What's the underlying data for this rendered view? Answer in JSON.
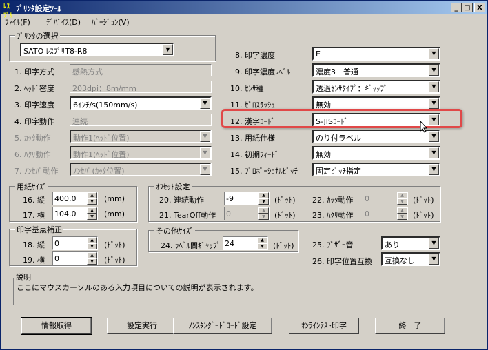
{
  "window": {
    "title": "ﾌﾟﾘﾝﾀ設定ﾂｰﾙ",
    "min": "_",
    "max": "□",
    "close": "X"
  },
  "menu": [
    "ﾌｧｲﾙ(F)",
    "ﾃﾞﾊﾞｲｽ(D)",
    "ﾊﾞｰｼﾞｮﾝ(V)"
  ],
  "printer_select": {
    "title": "ﾌﾟﾘﾝﾀの選択",
    "value": "SATO ﾚｽﾌﾟﾘT8-R8"
  },
  "left_settings": [
    {
      "label": "1. 印字方式",
      "value": "感熱方式",
      "kind": "field"
    },
    {
      "label": "2. ﾍｯﾄﾞ密度",
      "value": "203dpi：8ｍ/ｍｍ",
      "kind": "field"
    },
    {
      "label": "3. 印字速度",
      "value": "6ｲﾝﾁ/s(150mm/s)",
      "kind": "combo"
    },
    {
      "label": "4. 印字動作",
      "value": "連続",
      "kind": "field"
    },
    {
      "label": "5. ｶｯﾀ動作",
      "value": "動作1(ﾍｯﾄﾞ位置)",
      "kind": "disabled"
    },
    {
      "label": "6. ﾊｸﾘ動作",
      "value": "動作1(ﾍｯﾄﾞ位置)",
      "kind": "disabled"
    },
    {
      "label": "7. ﾉﾝｾﾊﾟ動作",
      "value": "ﾉﾝｾﾊﾟ(ｶｯﾀ位置)",
      "kind": "disabled"
    }
  ],
  "right_settings": [
    {
      "label": "8. 印字濃度",
      "value": "E"
    },
    {
      "label": "9. 印字濃度ﾚﾍﾞﾙ",
      "value": "濃度3　普通"
    },
    {
      "label": "10. ｾﾝｻ種",
      "value": "透過ｾﾝｻﾀｲﾌﾟ：ｷﾞｬｯﾌﾟ"
    },
    {
      "label": "11. ｾﾞﾛｽﾗｯｼｭ",
      "value": "無効"
    },
    {
      "label": "12. 漢字ｺｰﾄﾞ",
      "value": "S-JISｺｰﾄﾞ"
    },
    {
      "label": "13. 用紙仕様",
      "value": "のり付ラベル"
    },
    {
      "label": "14. 初期ﾌｨｰﾄﾞ",
      "value": "無効"
    },
    {
      "label": "15. ﾌﾟﾛﾎﾟｰｼｮﾅﾙﾋﾟｯﾁ",
      "value": "固定ﾋﾟｯﾁ指定"
    }
  ],
  "paper_size": {
    "title": "用紙ｻｲｽﾞ",
    "items": [
      {
        "label": "16. 縦",
        "value": "400.0",
        "unit": "(mm)"
      },
      {
        "label": "17. 横",
        "value": "104.0",
        "unit": "(mm)"
      }
    ]
  },
  "offset": {
    "title": "ｵﾌｾｯﾄ設定",
    "items": [
      {
        "label": "20. 連続動作",
        "value": "-9",
        "unit": "(ﾄﾞｯﾄ)",
        "enabled": true
      },
      {
        "label": "21. TearOff動作",
        "value": "0",
        "unit": "(ﾄﾞｯﾄ)",
        "enabled": false
      },
      {
        "label": "22. ｶｯﾀ動作",
        "value": "0",
        "unit": "(ﾄﾞｯﾄ)",
        "enabled": false
      },
      {
        "label": "23. ﾊｸﾘ動作",
        "value": "0",
        "unit": "(ﾄﾞｯﾄ)",
        "enabled": false
      }
    ]
  },
  "base_point": {
    "title": "印字基点補正",
    "items": [
      {
        "label": "18. 縦",
        "value": "0",
        "unit": "(ﾄﾞｯﾄ)"
      },
      {
        "label": "19. 横",
        "value": "0",
        "unit": "(ﾄﾞｯﾄ)"
      }
    ]
  },
  "other_size": {
    "title": "その他ｻｲｽﾞ",
    "label": "24. ﾗﾍﾞﾙ間ｷﾞｬｯﾌﾟ",
    "value": "24",
    "unit": "(ﾄﾞｯﾄ)"
  },
  "buzzer": {
    "label": "25. ﾌﾞｻﾞｰ音",
    "value": "あり"
  },
  "swap": {
    "label": "26. 印字位置互換",
    "value": "互換なし"
  },
  "description": {
    "title": "説明",
    "text": "ここにマウスカーソルのある入力項目についての説明が表示されます。"
  },
  "buttons": [
    "情報取得",
    "設定実行",
    "ﾉﾝｽﾀﾝﾀﾞｰﾄﾞｺｰﾄﾞ設定",
    "ｵﾝﾗｲﾝﾃｽﾄ印字",
    "終　了"
  ],
  "colors": {
    "titlebar": "#0a246a",
    "face": "#d4d0c8",
    "highlight": "#e04848"
  }
}
